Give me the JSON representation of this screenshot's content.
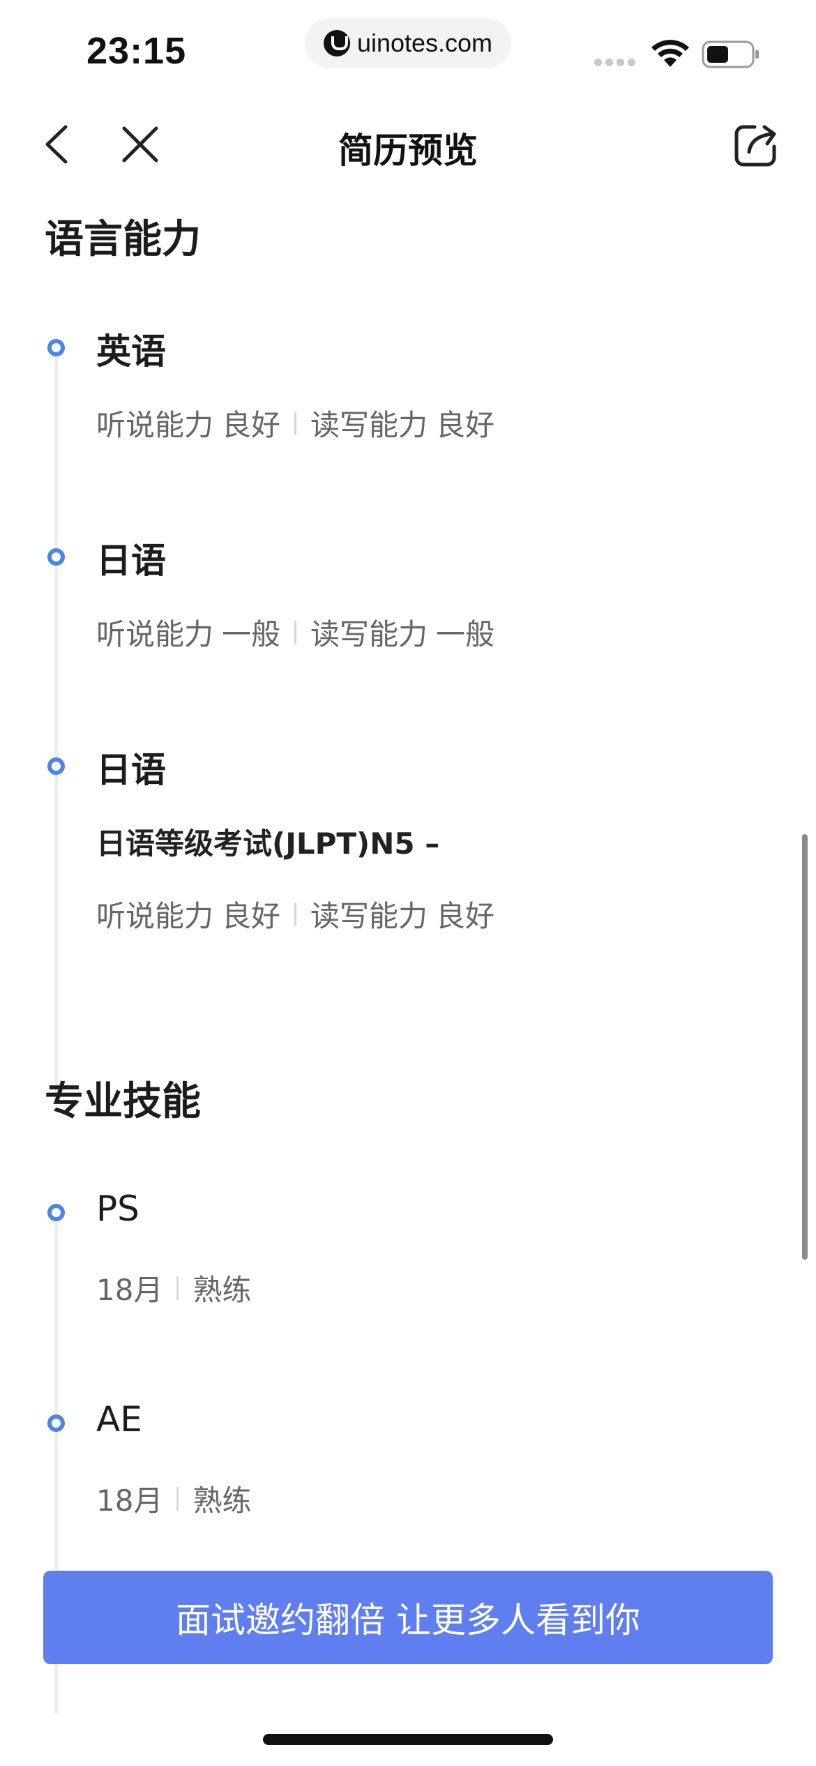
{
  "status_bar": {
    "time": "23:15",
    "url": "uinotes.com"
  },
  "nav": {
    "title": "简历预览"
  },
  "sections": {
    "language": {
      "title": "语言能力",
      "items": [
        {
          "title": "英语",
          "listening_label": "听说能力",
          "listening_level": "良好",
          "writing_label": "读写能力",
          "writing_level": "良好"
        },
        {
          "title": "日语",
          "listening_label": "听说能力",
          "listening_level": "一般",
          "writing_label": "读写能力",
          "writing_level": "一般"
        },
        {
          "title": "日语",
          "exam": "日语等级考试(JLPT)N5 –",
          "listening_label": "听说能力",
          "listening_level": "良好",
          "writing_label": "读写能力",
          "writing_level": "良好"
        }
      ]
    },
    "skills": {
      "title": "专业技能",
      "items": [
        {
          "title": "PS",
          "duration": "18月",
          "level": "熟练"
        },
        {
          "title": "AE",
          "duration": "18月",
          "level": "熟练"
        }
      ]
    }
  },
  "cta": {
    "label": "面试邀约翻倍 让更多人看到你"
  },
  "colors": {
    "accent": "#4a86e8",
    "cta_bg": "#5f7ef0",
    "text_primary": "#1c1c1c",
    "text_secondary": "#666666"
  }
}
